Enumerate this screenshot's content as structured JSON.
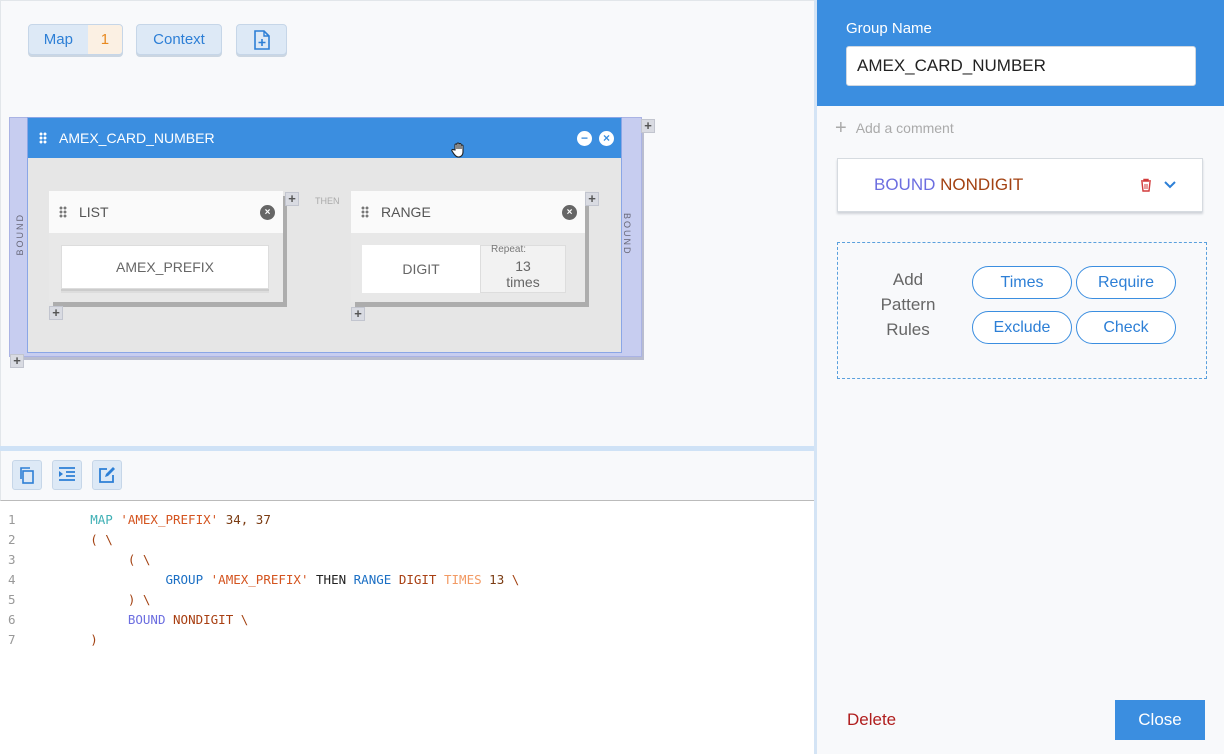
{
  "toolbar": {
    "map_label": "Map",
    "map_count": "1",
    "context_label": "Context"
  },
  "canvas": {
    "bound_label": "BOUND",
    "group": {
      "title": "AMEX_CARD_NUMBER"
    },
    "then_label": "THEN",
    "list_node": {
      "title": "LIST",
      "value": "AMEX_PREFIX"
    },
    "range_node": {
      "title": "RANGE",
      "value": "DIGIT",
      "repeat_label": "Repeat:",
      "repeat_count": "13",
      "repeat_unit": "times"
    }
  },
  "code": {
    "lines": [
      {
        "n": "1"
      },
      {
        "n": "2"
      },
      {
        "n": "3"
      },
      {
        "n": "4"
      },
      {
        "n": "5"
      },
      {
        "n": "6"
      },
      {
        "n": "7"
      }
    ],
    "tokens": {
      "map": "MAP",
      "amex_prefix_str": "'AMEX_PREFIX'",
      "map_values": "34, 37",
      "open_paren": "(",
      "backslash": "\\",
      "group": "GROUP",
      "then": "THEN",
      "range": "RANGE",
      "digit": "DIGIT",
      "times": "TIMES",
      "count": "13",
      "close_paren": ")",
      "bound": "BOUND",
      "nondigit": "NONDIGIT"
    }
  },
  "panel": {
    "group_name_label": "Group Name",
    "group_name_value": "AMEX_CARD_NUMBER",
    "add_comment": "Add a comment",
    "rule": {
      "keyword": "BOUND",
      "value": "NONDIGIT"
    },
    "add_pattern_rules": "Add Pattern Rules",
    "buttons": {
      "times": "Times",
      "require": "Require",
      "exclude": "Exclude",
      "check": "Check"
    },
    "delete_label": "Delete",
    "close_label": "Close"
  },
  "colors": {
    "accent": "#3b8ee0",
    "bound": "#c7cdf0",
    "delete": "#b01e1e"
  }
}
